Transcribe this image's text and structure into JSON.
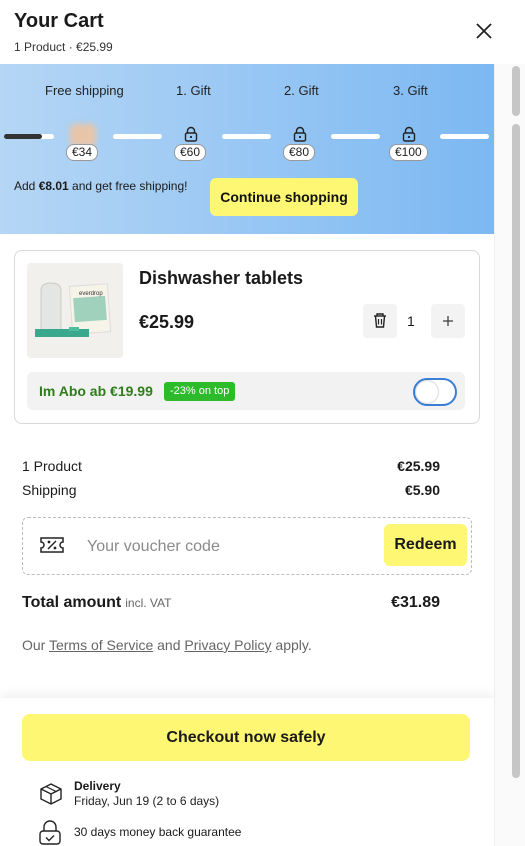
{
  "header": {
    "title": "Your Cart",
    "subtitle": "1 Product · €25.99"
  },
  "shipping_bar": {
    "milestones": [
      {
        "label": "Free shipping",
        "price": "€34"
      },
      {
        "label": "1. Gift",
        "price": "€60"
      },
      {
        "label": "2. Gift",
        "price": "€80"
      },
      {
        "label": "3. Gift",
        "price": "€100"
      }
    ],
    "progress_fraction": 0.35,
    "add_prefix": "Add ",
    "add_amount": "€8.01",
    "add_suffix": " and get free shipping!",
    "continue_label": "Continue shopping"
  },
  "product": {
    "name": "Dishwasher tablets",
    "price": "€25.99",
    "quantity": "1",
    "image_brand": "everdrop",
    "subscription_text": "Im Abo ab €19.99",
    "subscription_badge": "-23% on top",
    "subscription_enabled": false
  },
  "summary": {
    "products_label": "1 Product",
    "products_value": "€25.99",
    "shipping_label": "Shipping",
    "shipping_value": "€5.90",
    "voucher_placeholder": "Your voucher code",
    "redeem_label": "Redeem",
    "total_label": "Total amount",
    "total_vat": "incl. VAT",
    "total_value": "€31.89",
    "terms_prefix": "Our ",
    "terms_link": "Terms of Service",
    "terms_and": " and ",
    "privacy_link": "Privacy Policy",
    "terms_suffix": " apply."
  },
  "footer": {
    "checkout_label": "Checkout now safely",
    "delivery_title": "Delivery",
    "delivery_date": "Friday, Jun 19 (2 to 6 days)",
    "guarantee": "30 days money back guarantee"
  },
  "colors": {
    "accent_yellow": "#fdf773",
    "banner_blue": "#7cb8f2",
    "abo_green": "#2f7d1a",
    "badge_green": "#2dbb2b",
    "toggle_blue": "#3b7ed8"
  }
}
